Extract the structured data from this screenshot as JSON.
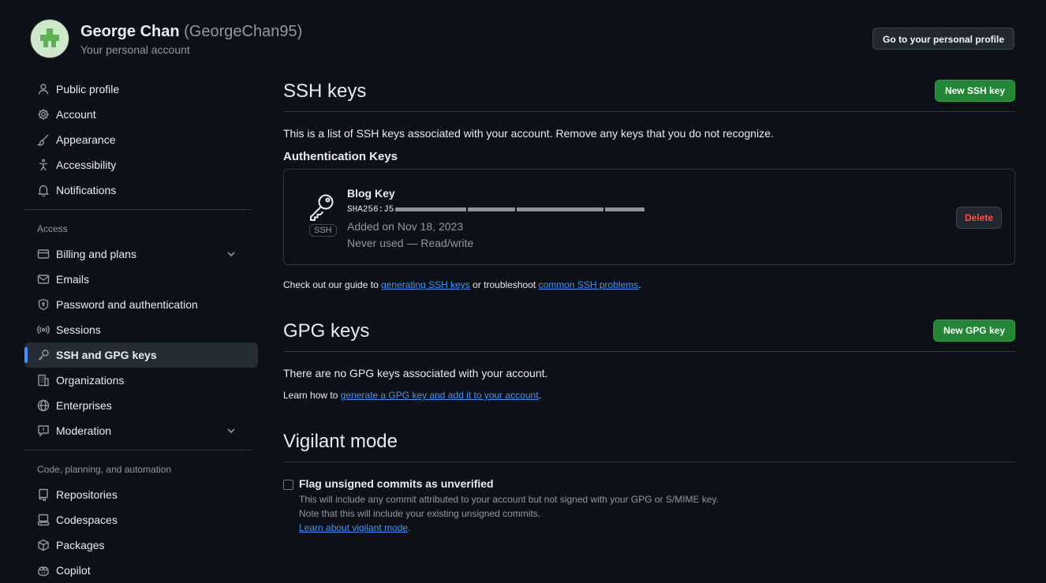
{
  "header": {
    "name": "George Chan",
    "handle": "(GeorgeChan95)",
    "subtitle": "Your personal account",
    "profile_button": "Go to your personal profile"
  },
  "sidebar": {
    "items_top": [
      {
        "label": "Public profile",
        "icon": "person-icon"
      },
      {
        "label": "Account",
        "icon": "gear-icon"
      },
      {
        "label": "Appearance",
        "icon": "paintbrush-icon"
      },
      {
        "label": "Accessibility",
        "icon": "accessibility-icon"
      },
      {
        "label": "Notifications",
        "icon": "bell-icon"
      }
    ],
    "access_title": "Access",
    "items_access": [
      {
        "label": "Billing and plans",
        "icon": "credit-card-icon",
        "expandable": true
      },
      {
        "label": "Emails",
        "icon": "mail-icon"
      },
      {
        "label": "Password and authentication",
        "icon": "shield-lock-icon"
      },
      {
        "label": "Sessions",
        "icon": "broadcast-icon"
      },
      {
        "label": "SSH and GPG keys",
        "icon": "key-icon",
        "active": true
      },
      {
        "label": "Organizations",
        "icon": "organization-icon"
      },
      {
        "label": "Enterprises",
        "icon": "globe-icon"
      },
      {
        "label": "Moderation",
        "icon": "report-icon",
        "expandable": true
      }
    ],
    "code_title": "Code, planning, and automation",
    "items_code": [
      {
        "label": "Repositories",
        "icon": "repo-icon"
      },
      {
        "label": "Codespaces",
        "icon": "codespaces-icon"
      },
      {
        "label": "Packages",
        "icon": "package-icon"
      },
      {
        "label": "Copilot",
        "icon": "copilot-icon"
      }
    ]
  },
  "ssh": {
    "title": "SSH keys",
    "new_button": "New SSH key",
    "description": "This is a list of SSH keys associated with your account. Remove any keys that you do not recognize.",
    "auth_title": "Authentication Keys",
    "key": {
      "name": "Blog Key",
      "fingerprint_prefix": "SHA256:J5",
      "type_label": "SSH",
      "added": "Added on Nov 18, 2023",
      "usage": "Never used — Read/write",
      "delete_button": "Delete"
    },
    "guide": {
      "prefix": "Check out our guide to ",
      "link1": "generating SSH keys",
      "middle": " or troubleshoot ",
      "link2": "common SSH problems",
      "suffix": "."
    }
  },
  "gpg": {
    "title": "GPG keys",
    "new_button": "New GPG key",
    "empty": "There are no GPG keys associated with your account.",
    "learn_prefix": "Learn how to ",
    "learn_link": "generate a GPG key and add it to your account",
    "learn_suffix": "."
  },
  "vigilant": {
    "title": "Vigilant mode",
    "checkbox_label": "Flag unsigned commits as unverified",
    "checked": false,
    "desc1": "This will include any commit attributed to your account but not signed with your GPG or S/MIME key.",
    "desc2": "Note that this will include your existing unsigned commits.",
    "link": "Learn about vigilant mode",
    "link_suffix": "."
  },
  "colors": {
    "background": "#0d1117",
    "accent": "#4493f8",
    "green_button": "#238636",
    "danger": "#f85149"
  }
}
